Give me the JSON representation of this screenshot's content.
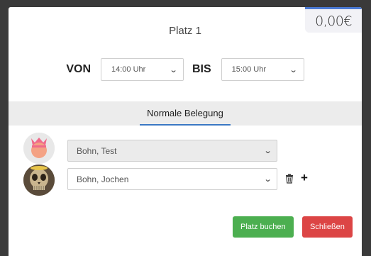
{
  "price": "0,00€",
  "title": "Platz 1",
  "time": {
    "from_label": "VON",
    "from_value": "14:00 Uhr",
    "to_label": "BIS",
    "to_value": "15:00 Uhr"
  },
  "tabs": [
    {
      "label": "Normale Belegung",
      "active": true
    }
  ],
  "players": [
    {
      "name": "Bohn, Test",
      "avatar": "pink-avatar"
    },
    {
      "name": "Bohn, Jochen",
      "avatar": "skull-photo-avatar"
    }
  ],
  "icons": {
    "dropdown": "chevron-down-icon",
    "delete": "trash-icon",
    "add": "plus-icon"
  },
  "buttons": {
    "book": "Platz buchen",
    "close": "Schließen"
  },
  "colors": {
    "accent": "#3a78c3",
    "book": "#4caf50",
    "close": "#dc4545"
  }
}
